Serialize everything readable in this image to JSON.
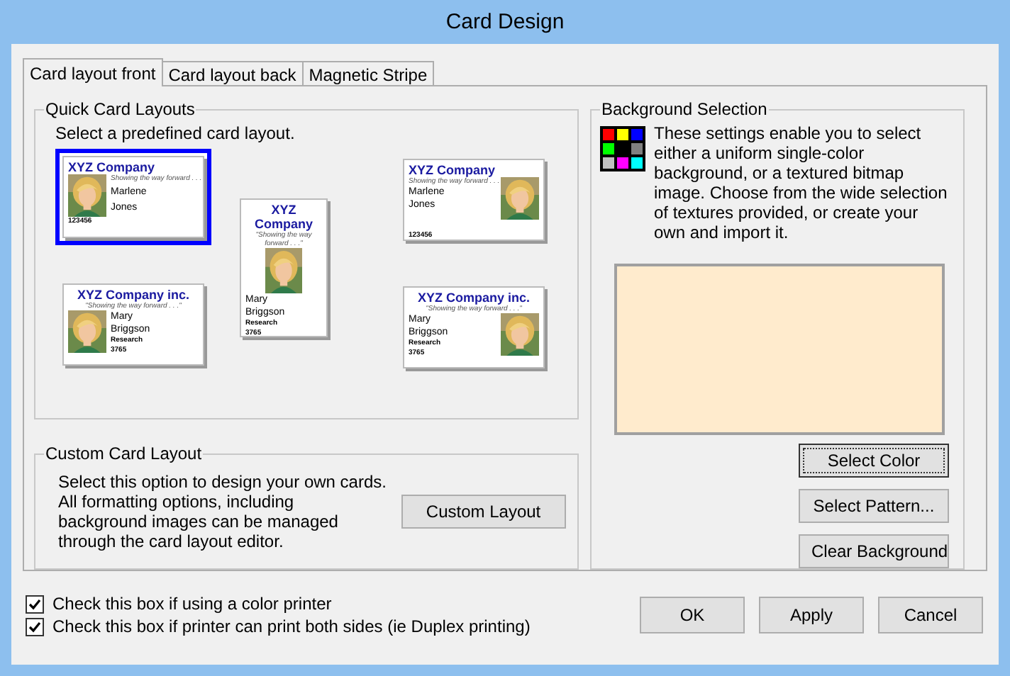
{
  "window": {
    "title": "Card Design"
  },
  "tabs": [
    {
      "label": "Card layout front",
      "selected": true
    },
    {
      "label": "Card layout back",
      "selected": false
    },
    {
      "label": "Magnetic Stripe",
      "selected": false
    }
  ],
  "quick_layouts": {
    "title": "Quick Card Layouts",
    "instruction": "Select a predefined card layout.",
    "cards": [
      {
        "kind": "photo-left",
        "selected": true,
        "company": "XYZ Company",
        "tagline": "Showing the way forward . . .",
        "first": "Marlene",
        "last": "Jones",
        "number": "123456"
      },
      {
        "kind": "portrait",
        "selected": false,
        "company": "XYZ Company",
        "tagline": "\"Showing the way forward . . .\"",
        "first": "Mary",
        "last": "Briggson",
        "dept": "Research",
        "number": "3765"
      },
      {
        "kind": "photo-right",
        "selected": false,
        "company": "XYZ Company",
        "tagline": "Showing the way forward . . .",
        "first": "Marlene",
        "last": "Jones",
        "number": "123456"
      },
      {
        "kind": "banner-photo-left",
        "selected": false,
        "company": "XYZ Company inc.",
        "tagline": "\"Showing the way forward . . .\"",
        "first": "Mary",
        "last": "Briggson",
        "dept": "Research",
        "number": "3765"
      },
      {
        "kind": "banner-photo-right",
        "selected": false,
        "company": "XYZ Company inc.",
        "tagline": "\"Showing the way forward . . .\"",
        "first": "Mary",
        "last": "Briggson",
        "dept": "Research",
        "number": "3765"
      }
    ]
  },
  "custom_layout": {
    "title": "Custom Card Layout",
    "description": "Select this option to design your own cards. All formatting options, including background images can be managed through the card layout editor.",
    "button": "Custom Layout"
  },
  "background": {
    "title": "Background Selection",
    "description": "These settings enable you to select either a uniform single-color background, or a textured bitmap image. Choose from the wide selection of textures provided, or create your own and import it.",
    "buttons": [
      {
        "label": "Select Color",
        "focused": true
      },
      {
        "label": "Select Pattern...",
        "focused": false
      },
      {
        "label": "Clear Background",
        "focused": false
      }
    ]
  },
  "options": [
    {
      "label": "Check this box if using a color printer",
      "checked": true
    },
    {
      "label": "Check this box if printer can print both sides (ie Duplex printing)",
      "checked": true
    }
  ],
  "buttons": [
    "OK",
    "Apply",
    "Cancel"
  ]
}
